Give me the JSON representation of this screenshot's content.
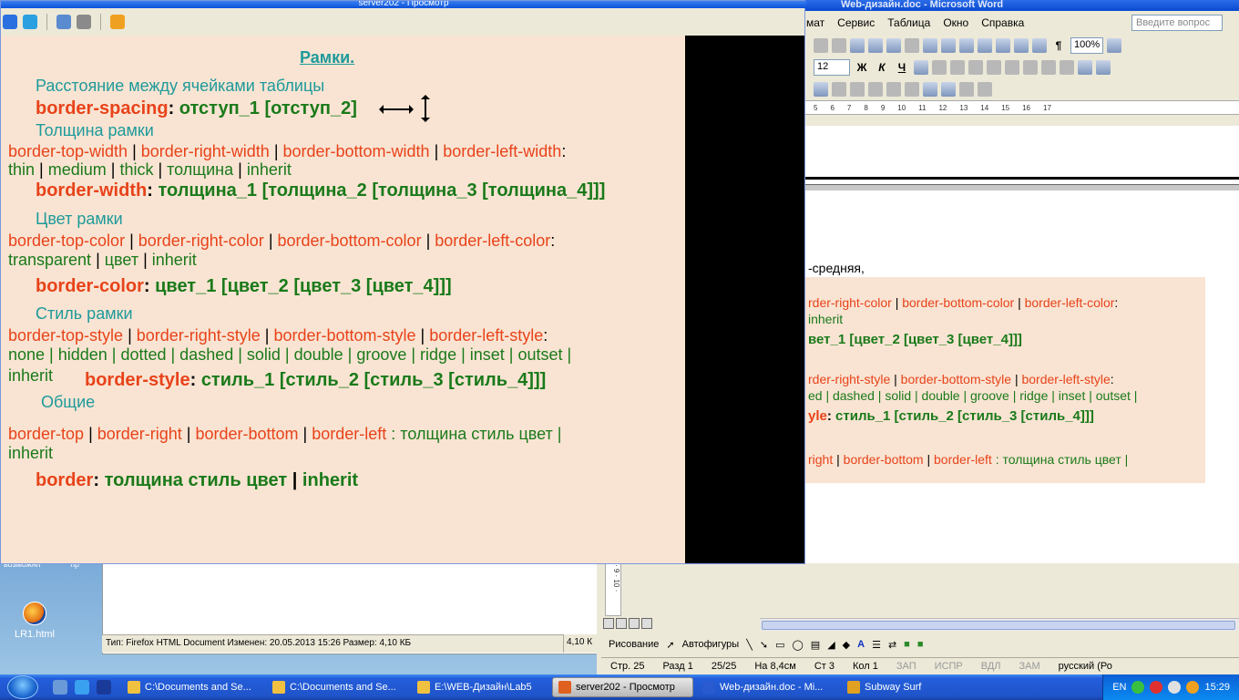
{
  "desktop": {
    "icon_label": "LR1.html",
    "top_fragment": "возможнп",
    "top_fragment2": "пр"
  },
  "explorer": {
    "status": "Тип: Firefox HTML Document Изменен: 20.05.2013 15:26 Размер: 4,10 КБ",
    "size": "4,10 К"
  },
  "viewer": {
    "title": "server202 - Просмотр",
    "slide": {
      "title": "Рамки.",
      "spacing_heading": "Расстояние между ячейками таблицы",
      "spacing_prop": "border-spacing",
      "spacing_value": "отступ_1",
      "spacing_opt": "[отступ_2]",
      "width_heading": "Толщина рамки",
      "width_props": [
        "border-top-width",
        "border-right-width",
        "border-bottom-width",
        "border-left-width"
      ],
      "width_values": [
        "thin",
        "medium",
        "thick",
        "толщина",
        "inherit"
      ],
      "width_shorthand": "border-width",
      "width_shorthand_value": "толщина_1 [толщина_2 [толщина_3 [толщина_4]]]",
      "color_heading": "Цвет рамки",
      "color_props": [
        "border-top-color",
        "border-right-color",
        "border-bottom-color",
        "border-left-color"
      ],
      "color_values": [
        "transparent",
        "цвет",
        "inherit"
      ],
      "color_shorthand": "border-color",
      "color_shorthand_value": "цвет_1 [цвет_2 [цвет_3 [цвет_4]]]",
      "style_heading": "Стиль рамки",
      "style_props": [
        "border-top-style",
        "border-right-style",
        "border-bottom-style",
        "border-left-style"
      ],
      "style_values_line1": "none | hidden | dotted | dashed | solid | double | groove | ridge | inset | outset |",
      "style_values_line2": "inherit",
      "style_shorthand": "border-style",
      "style_shorthand_value": "стиль_1 [стиль_2 [стиль_3 [стиль_4]]]",
      "general_heading": "Общие",
      "general_props": [
        "border-top",
        "border-right",
        "border-bottom",
        "border-left"
      ],
      "general_value": ": толщина стиль цвет |",
      "general_value2": "inherit",
      "border_prop": "border",
      "border_value": "толщина стиль цвет",
      "border_inherit": "inherit"
    }
  },
  "word": {
    "title": "Web-дизайн.doc - Microsoft Word",
    "menu": [
      "мат",
      "Сервис",
      "Таблица",
      "Окно",
      "Справка"
    ],
    "help_placeholder": "Введите вопрос",
    "zoom": "100%",
    "font_size": "12",
    "ruler_ticks": [
      "5",
      "6",
      "7",
      "8",
      "9",
      "10",
      "11",
      "12",
      "13",
      "14",
      "15",
      "16",
      "17"
    ],
    "doc_text": "-средняя,",
    "doc_lines": {
      "l1a": "rder-right-color",
      "l1b": "border-bottom-color",
      "l1c": "border-left-color",
      "l2": "inherit",
      "l3": "вет_1 [цвет_2 [цвет_3 [цвет_4]]]",
      "l4a": "rder-right-style",
      "l4b": "border-bottom-style",
      "l4c": "border-left-style",
      "l5": "ed | dashed | solid | double | groove | ridge | inset | outset |",
      "l6a": "yle",
      "l6b": "стиль_1 [стиль_2 [стиль_3 [стиль_4]]]",
      "l7a": "right",
      "l7b": "border-bottom",
      "l7c": "border-left",
      "l7d": ": толщина стиль цвет |"
    },
    "draw_toolbar": [
      "Рисование",
      "Автофигуры"
    ],
    "status": {
      "page": "Стр. 25",
      "section": "Разд 1",
      "pages": "25/25",
      "at": "На 8,4см",
      "line": "Ст 3",
      "col": "Кол 1",
      "rec": "ЗАП",
      "trk": "ИСПР",
      "ext": "ВДЛ",
      "ovr": "ЗАМ",
      "lang": "русский (Ро"
    }
  },
  "taskbar": {
    "tasks": [
      "C:\\Documents and Se...",
      "C:\\Documents and Se...",
      "E:\\WEB-Дизайн\\Lab5",
      "server202 - Просмотр",
      "Web-дизайн.doc - Mi...",
      "Subway Surf"
    ],
    "lang": "EN",
    "clock": "15:29"
  }
}
